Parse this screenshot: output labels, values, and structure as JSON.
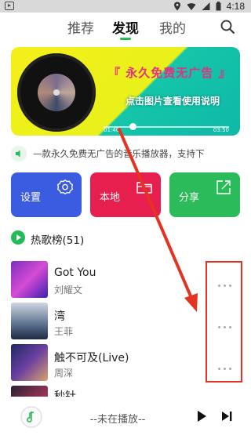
{
  "status_bar": {
    "time": "4:18"
  },
  "tabs": [
    {
      "label": "推荐"
    },
    {
      "label": "发现"
    },
    {
      "label": "我的"
    }
  ],
  "banner": {
    "title": "『 永久免费无广告 』",
    "subtitle": "点击图片查看使用说明",
    "time_start": "01:40",
    "time_end": "03:50"
  },
  "marquee": {
    "text": "—款永久免费无广告的音乐播放器，支持下"
  },
  "actions": [
    {
      "label": "设置",
      "color": "#3b5be0"
    },
    {
      "label": "本地",
      "color": "#e61f4e"
    },
    {
      "label": "分享",
      "color": "#2cbb5a"
    }
  ],
  "hot_list": {
    "title": "热歌榜(51)"
  },
  "songs": [
    {
      "title": "Got You",
      "artist": "刘耀文"
    },
    {
      "title": "湾",
      "artist": "王菲"
    },
    {
      "title": "触不可及(Live)",
      "artist": "周深"
    },
    {
      "title": "秒针",
      "artist": ""
    }
  ],
  "player": {
    "status": "--未在播放--"
  },
  "colors": {
    "accent": "#22bb55",
    "annotation": "#e53322"
  }
}
